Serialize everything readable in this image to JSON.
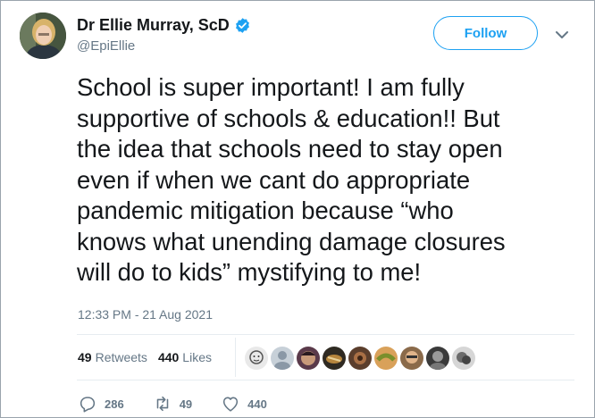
{
  "author": {
    "name": "Dr Ellie Murray, ScD",
    "handle": "@EpiEllie",
    "verified": true
  },
  "follow_label": "Follow",
  "tweet": {
    "lines": [
      "School is super important! I am fully",
      "supportive of schools & education!! But",
      "the idea that schools need to stay open",
      "even if when we cant do appropriate",
      "pandemic mitigation because “who",
      "knows what unending damage closures",
      "will do to kids” mystifying to me!"
    ],
    "timestamp": "12:33 PM - 21 Aug 2021"
  },
  "stats": {
    "retweets_count": "49",
    "retweets_label": "Retweets",
    "likes_count": "440",
    "likes_label": "Likes"
  },
  "actions": {
    "replies": "286",
    "retweets": "49",
    "likes": "440"
  },
  "colors": {
    "accent": "#1da1f2",
    "secondary_text": "#657786",
    "primary_text": "#14171a"
  }
}
